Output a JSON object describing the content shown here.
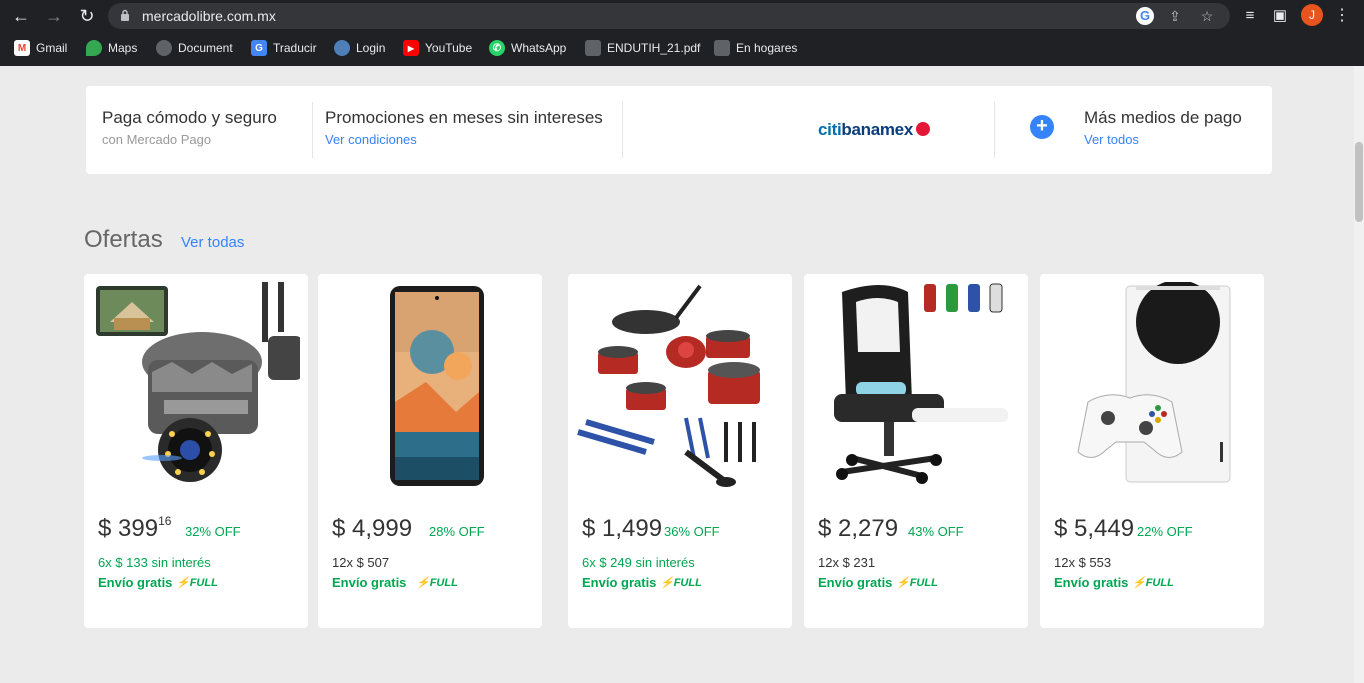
{
  "browser": {
    "url": "mercadolibre.com.mx",
    "profile_initial": "J",
    "bookmarks": [
      "Gmail",
      "Maps",
      "Document",
      "Traducir",
      "Login",
      "YouTube",
      "WhatsApp",
      "ENDUTIH_21.pdf",
      "En hogares"
    ]
  },
  "payments": {
    "secure_title": "Paga cómodo y seguro",
    "secure_sub": "con Mercado Pago",
    "promo_title": "Promociones en meses sin intereses",
    "promo_link": "Ver condiciones",
    "bank_logo": "citibanamex",
    "bank_logo_part1": "citi",
    "bank_logo_part2": "banamex",
    "more_title": "Más medios de pago",
    "more_link": "Ver todos"
  },
  "offers": {
    "title": "Ofertas",
    "see_all": "Ver todas",
    "items": [
      {
        "image": "security-camera",
        "price": "$ 399",
        "cents": "16",
        "discount": "32% OFF",
        "installments": "6x $ 133 sin interés",
        "installments_free": true,
        "shipping": "Envío gratis",
        "full": "FULL"
      },
      {
        "image": "smartphone",
        "price": "$ 4,999",
        "cents": "",
        "discount": "28% OFF",
        "installments": "12x $ 507",
        "installments_free": false,
        "shipping": "Envío gratis",
        "full": "FULL"
      },
      {
        "image": "cookware-set",
        "price": "$ 1,499",
        "cents": "",
        "discount": "36% OFF",
        "installments": "6x $ 249 sin interés",
        "installments_free": true,
        "shipping": "Envío gratis",
        "full": "FULL"
      },
      {
        "image": "gaming-chair",
        "price": "$ 2,279",
        "cents": "",
        "discount": "43% OFF",
        "installments": "12x $ 231",
        "installments_free": false,
        "shipping": "Envío gratis",
        "full": "FULL"
      },
      {
        "image": "game-console",
        "price": "$ 5,449",
        "cents": "",
        "discount": "22% OFF",
        "installments": "12x $ 553",
        "installments_free": false,
        "shipping": "Envío gratis",
        "full": "FULL"
      }
    ]
  },
  "colors": {
    "link": "#3483fa",
    "green": "#00a650",
    "page_bg": "#ebebeb",
    "chrome_bg": "#202124"
  }
}
